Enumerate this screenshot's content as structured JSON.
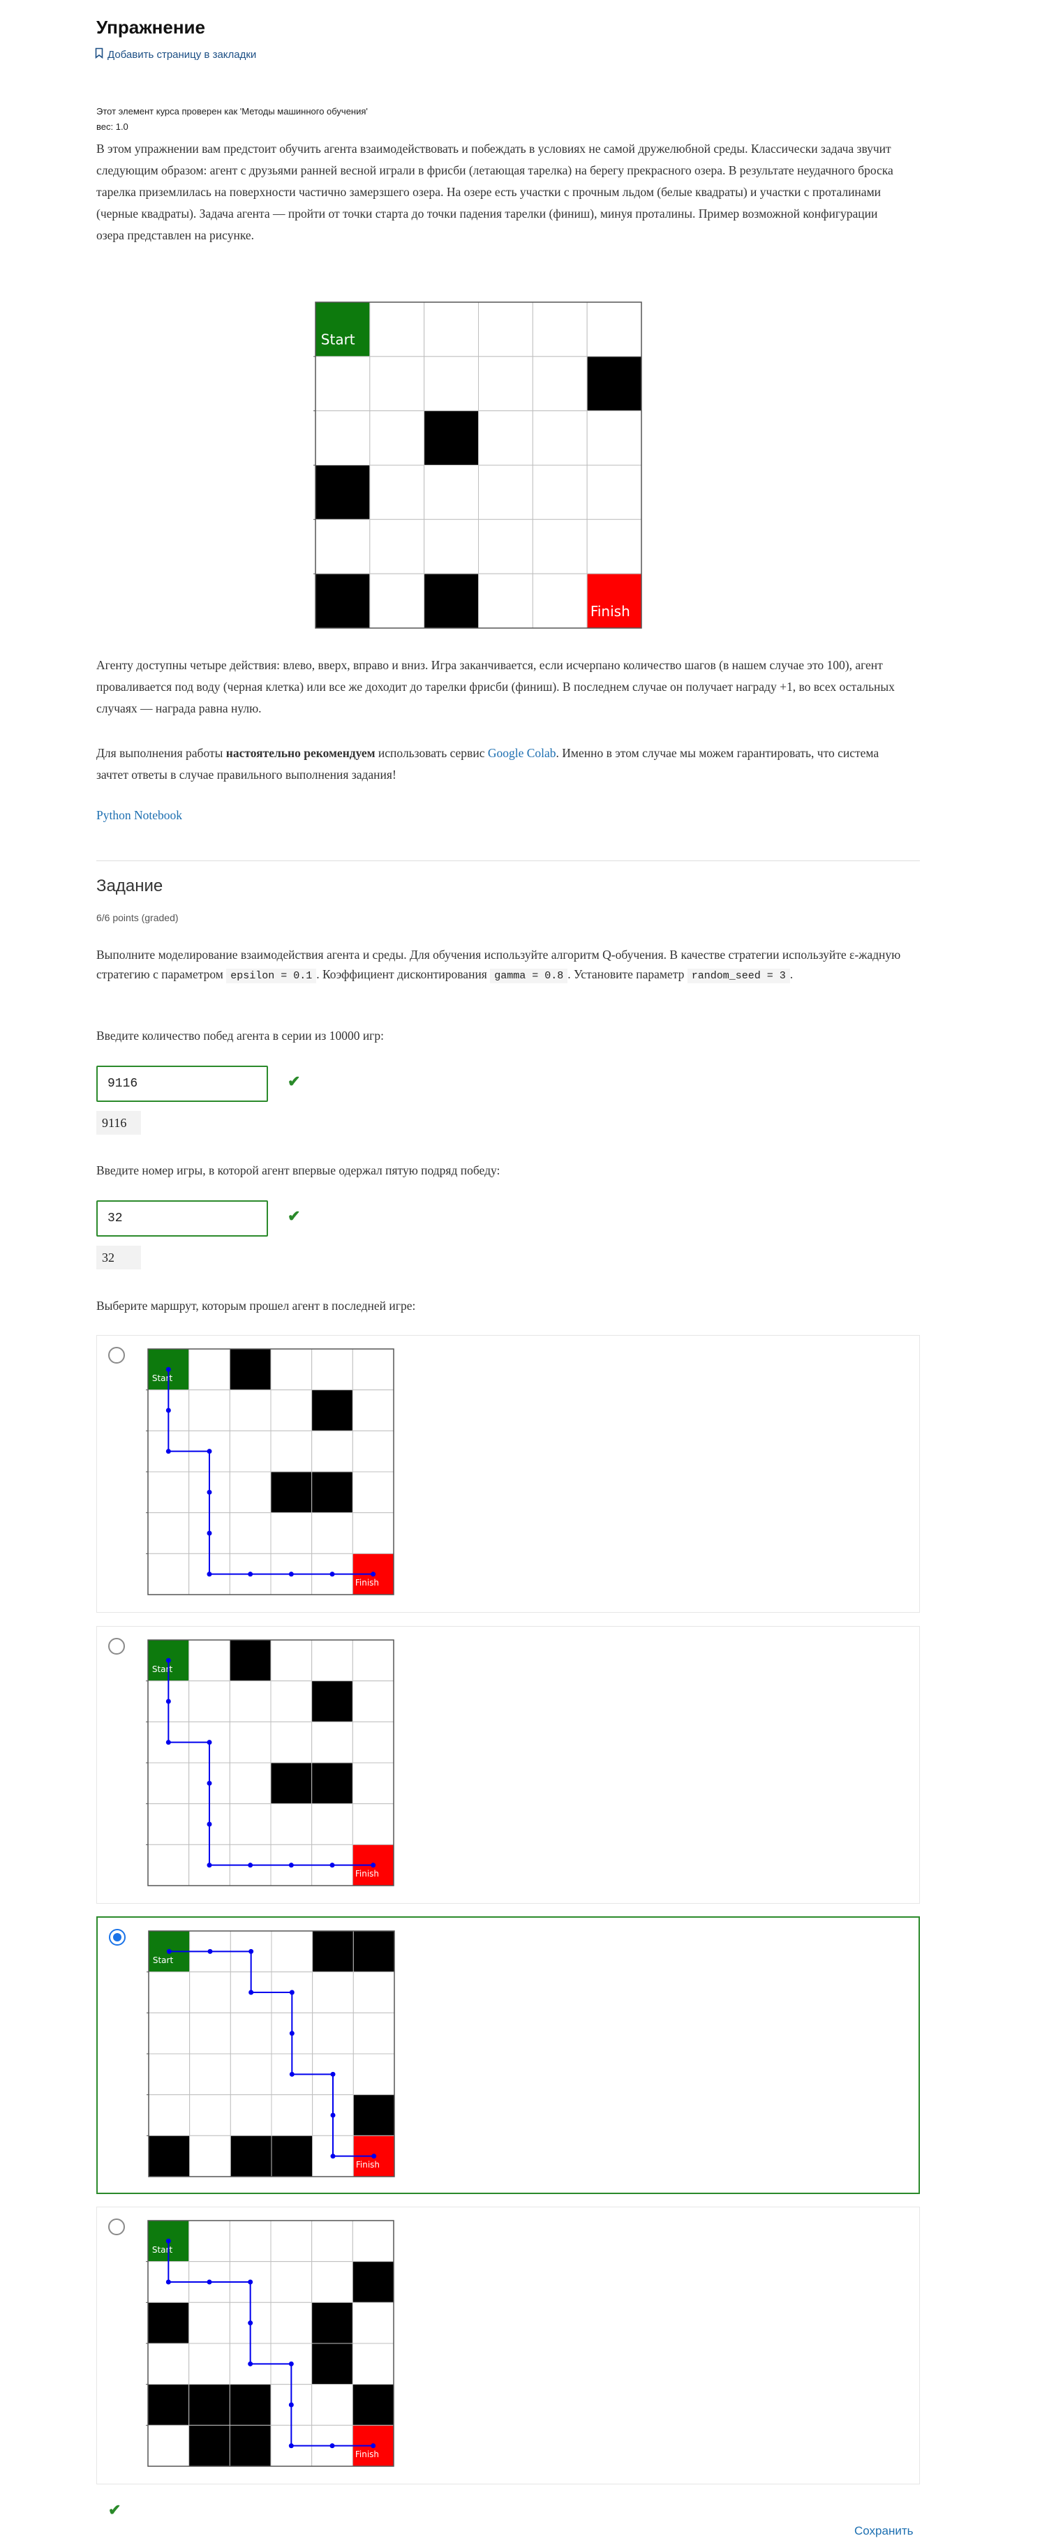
{
  "header": {
    "title": "Упражнение",
    "bookmark_label": "Добавить страницу в закладки"
  },
  "meta": {
    "checked_as": "Этот элемент курса проверен как 'Методы машинного обучения'",
    "weight": "вес: 1.0"
  },
  "intro": "В этом упражнении вам предстоит обучить агента взаимодействовать и побеждать в условиях не самой дружелюбной среды. Классически задача звучит следующим образом: агент с друзьями ранней весной играли в фрисби (летающая тарелка) на берегу прекрасного озера. В результате неудачного броска тарелка приземлилась на поверхности частично замерзшего озера. На озере есть участки с прочным льдом (белые квадраты) и участки с проталинами (черные квадраты). Задача агента — пройти от точки старта до точки падения тарелки (финиш), минуя проталины. Пример возможной конфигурации озера представлен на рисунке.",
  "main_grid": {
    "start_label": "Start",
    "finish_label": "Finish",
    "holes": [
      [
        1,
        5
      ],
      [
        2,
        2
      ],
      [
        3,
        0
      ],
      [
        5,
        0
      ],
      [
        5,
        2
      ]
    ],
    "colors": {
      "start": "#0d7a0d",
      "finish": "#ff0000",
      "hole": "#000000"
    }
  },
  "para_actions": "Агенту доступны четыре действия: влево, вверх, вправо и вниз. Игра заканчивается, если исчерпано количество шагов (в нашем случае это 100), агент проваливается под воду (черная клетка) или все же доходит до тарелки фрисби (финиш). В последнем случае он получает награду +1, во всех остальных случаях — награда равна нулю.",
  "para_colab": {
    "before": "Для выполнения работы ",
    "bold": "настоятельно рекомендуем",
    "middle": " использовать сервис ",
    "link": "Google Colab",
    "after": ". Именно в этом случае мы можем гарантировать, что система зачтет ответы в случае правильного выполнения задания!"
  },
  "notebook_link": "Python Notebook",
  "task": {
    "title": "Задание",
    "points": "6/6 points (graded)",
    "desc_1": "Выполните моделирование взаимодействия агента и среды. Для обучения используйте алгоритм Q-обучения. В качестве стратегии используйте ε-жадную стратегию с параметром ",
    "code_epsilon": "epsilon = 0.1",
    "desc_2": ". Коэффициент дисконтирования ",
    "code_gamma": "gamma = 0.8",
    "desc_3": ". Установите параметр ",
    "code_seed": "random_seed = 3",
    "desc_4": "."
  },
  "questions": {
    "q1_label": "Введите количество побед агента в серии из 10000 игр:",
    "q1_value": "9116",
    "q1_echo": "9116",
    "q2_label": "Введите номер игры, в которой агент впервые одержал пятую подряд победу:",
    "q2_value": "32",
    "q2_echo": "32",
    "q3_label": "Выберите маршрут, которым прошел агент в последней игре:"
  },
  "options": [
    {
      "selected": false,
      "holes": [
        [
          0,
          2
        ],
        [
          1,
          4
        ],
        [
          3,
          3
        ],
        [
          3,
          4
        ]
      ],
      "path": [
        [
          0,
          0
        ],
        [
          1,
          0
        ],
        [
          2,
          0
        ],
        [
          2,
          1
        ],
        [
          3,
          1
        ],
        [
          4,
          1
        ],
        [
          5,
          1
        ],
        [
          5,
          2
        ],
        [
          5,
          3
        ],
        [
          5,
          4
        ],
        [
          5,
          5
        ]
      ]
    },
    {
      "selected": false,
      "holes": [
        [
          0,
          2
        ],
        [
          1,
          4
        ],
        [
          3,
          3
        ],
        [
          3,
          4
        ]
      ],
      "path": [
        [
          0,
          0
        ],
        [
          1,
          0
        ],
        [
          2,
          0
        ],
        [
          2,
          1
        ],
        [
          3,
          1
        ],
        [
          4,
          1
        ],
        [
          5,
          1
        ],
        [
          5,
          2
        ],
        [
          5,
          3
        ],
        [
          5,
          4
        ],
        [
          5,
          5
        ]
      ]
    },
    {
      "selected": true,
      "holes": [
        [
          0,
          4
        ],
        [
          0,
          5
        ],
        [
          4,
          5
        ],
        [
          5,
          0
        ],
        [
          5,
          2
        ],
        [
          5,
          3
        ]
      ],
      "path": [
        [
          0,
          0
        ],
        [
          0,
          1
        ],
        [
          0,
          2
        ],
        [
          1,
          2
        ],
        [
          1,
          3
        ],
        [
          2,
          3
        ],
        [
          3,
          3
        ],
        [
          3,
          4
        ],
        [
          4,
          4
        ],
        [
          5,
          4
        ],
        [
          5,
          5
        ]
      ]
    },
    {
      "selected": false,
      "holes": [
        [
          1,
          5
        ],
        [
          2,
          0
        ],
        [
          2,
          4
        ],
        [
          3,
          4
        ],
        [
          4,
          0
        ],
        [
          4,
          1
        ],
        [
          4,
          2
        ],
        [
          4,
          5
        ],
        [
          5,
          1
        ],
        [
          5,
          2
        ]
      ],
      "path": [
        [
          0,
          0
        ],
        [
          1,
          0
        ],
        [
          1,
          1
        ],
        [
          1,
          2
        ],
        [
          2,
          2
        ],
        [
          3,
          2
        ],
        [
          3,
          3
        ],
        [
          4,
          3
        ],
        [
          5,
          3
        ],
        [
          5,
          4
        ],
        [
          5,
          5
        ]
      ]
    }
  ],
  "option_grid": {
    "start_label": "Start",
    "finish_label": "Finish",
    "path_color": "#0000ee"
  },
  "footer": {
    "save_label": "Сохранить"
  }
}
